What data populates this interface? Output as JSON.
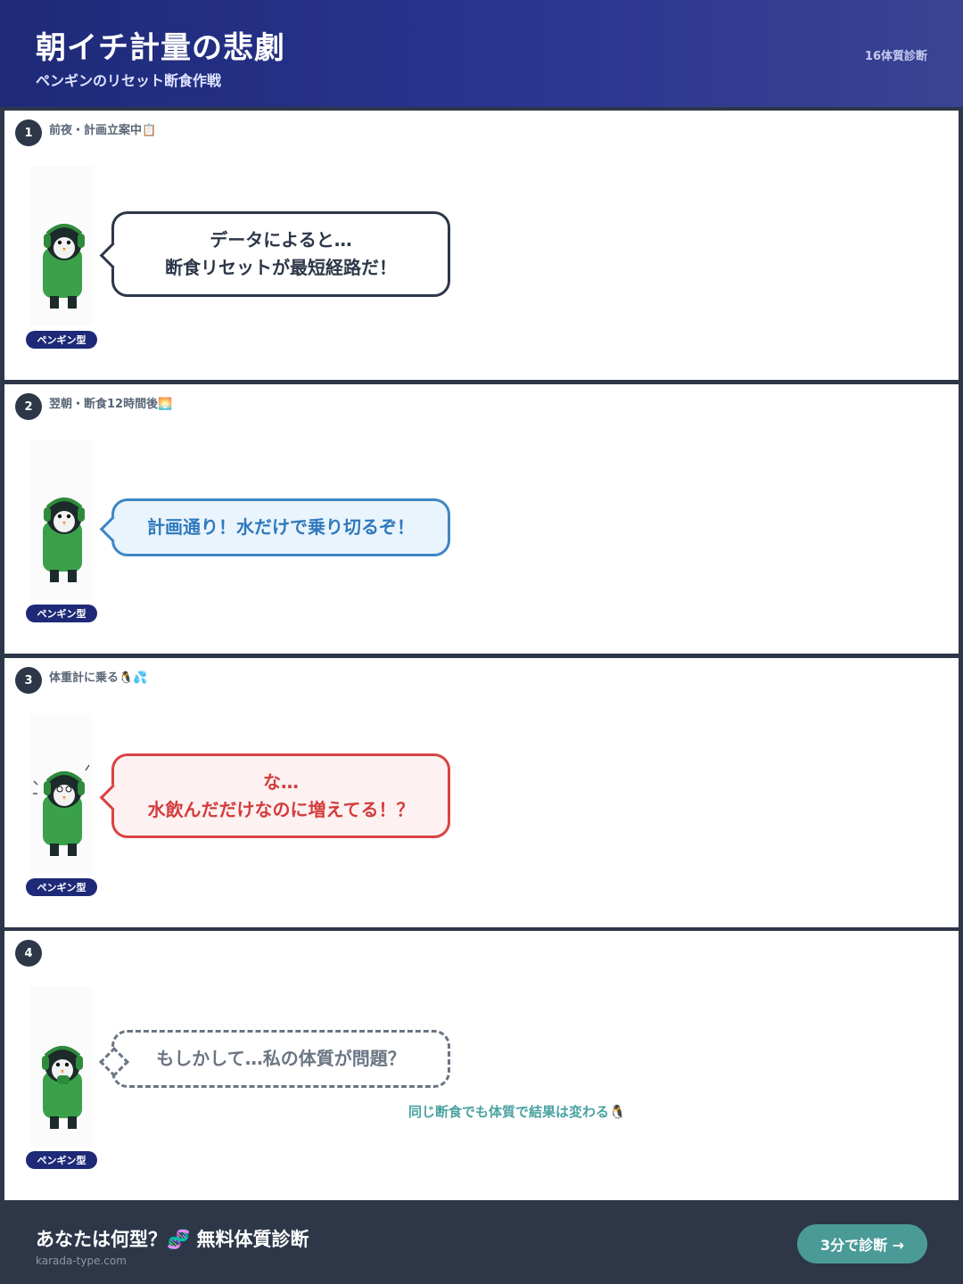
{
  "header": {
    "title": "朝イチ計量の悲劇",
    "subtitle": "ペンギンのリセット断食作戦",
    "badge": "16体質診断"
  },
  "panels": [
    {
      "number": "1",
      "caption": "前夜・計画立案中📋",
      "tag": "ペンギン型",
      "bubble_line1": "データによると…",
      "bubble_line2": "断食リセットが最短経路だ！"
    },
    {
      "number": "2",
      "caption": "翌朝・断食12時間後🌅",
      "tag": "ペンギン型",
      "bubble_line1": "計画通り！水だけで乗り切るぞ！"
    },
    {
      "number": "3",
      "caption": "体重計に乗る🐧💦",
      "tag": "ペンギン型",
      "bubble_line1": "な…",
      "bubble_line2": "水飲んだだけなのに増えてる！？"
    },
    {
      "number": "4",
      "caption": "",
      "tag": "ペンギン型",
      "bubble_line1": "もしかして…私の体質が問題？",
      "note": "同じ断食でも体質で結果は変わる🐧"
    }
  ],
  "footer": {
    "cta": "あなたは何型？🧬 無料体質診断",
    "site": "karada-type.com",
    "button": "3分で診断 →"
  },
  "colors": {
    "header": "#1e2a78",
    "accent_teal": "#4a9b98",
    "bubble_blue": "#3d86c6",
    "bubble_red": "#d94343",
    "dark": "#2d3748"
  },
  "icons": [
    "penguin-illustration",
    "clipboard-icon",
    "sunrise-icon",
    "penguin-icon",
    "sweat-icon",
    "dna-icon",
    "arrow-right-icon"
  ]
}
